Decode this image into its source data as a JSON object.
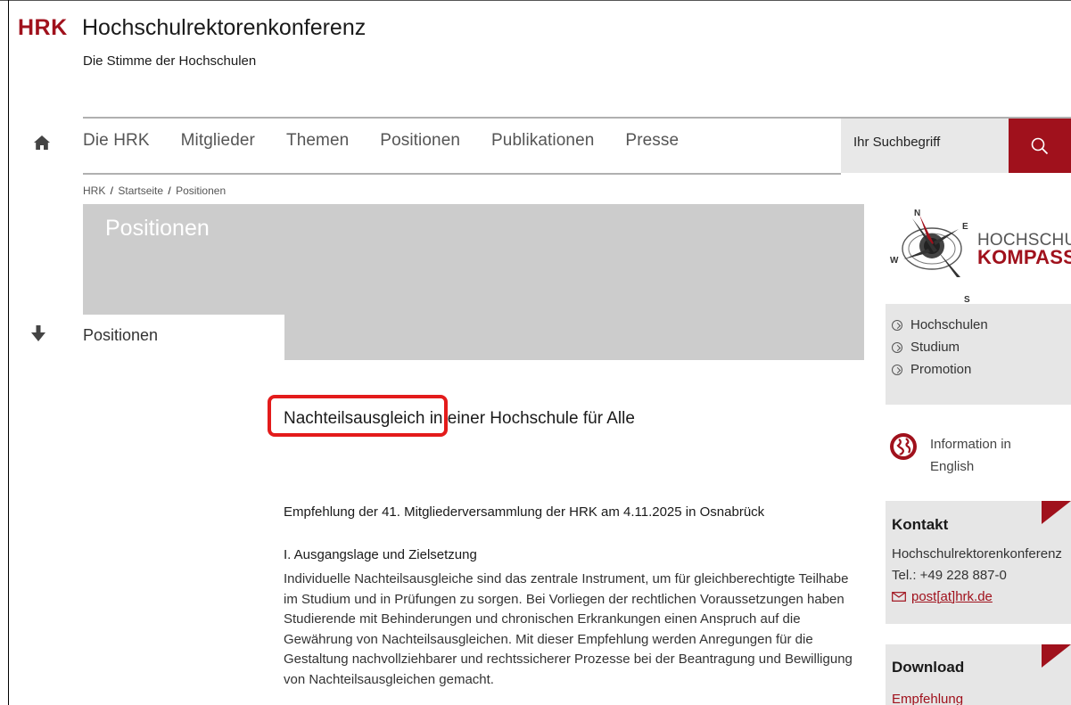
{
  "header": {
    "logo_abbr": "HRK",
    "logo_title": "Hochschulrektorenkonferenz",
    "logo_subtitle": "Die Stimme der Hochschulen"
  },
  "nav": {
    "home_icon": "home-icon",
    "items": [
      "Die HRK",
      "Mitglieder",
      "Themen",
      "Positionen",
      "Publikationen",
      "Presse"
    ]
  },
  "search": {
    "placeholder": "Ihr Suchbegriff",
    "button_icon": "search-icon"
  },
  "breadcrumb": [
    "HRK",
    "Startseite",
    "Positionen"
  ],
  "hero": {
    "title": "Positionen",
    "tab_label": "Positionen"
  },
  "article": {
    "title": "Nachteilsausgleich in einer Hochschule für Alle",
    "lead": "Empfehlung der 41. Mitgliederversammlung der HRK am 4.11.2025 in Osnabrück",
    "section_heading": "I. Ausgangslage und Zielsetzung",
    "body": "Individuelle Nachteilsausgleiche sind das zentrale Instrument, um für gleichberechtigte Teilhabe im Studium und in Prüfungen zu sorgen. Bei Vorliegen der rechtlichen Voraussetzungen haben Studierende mit Behinderungen und chronischen Erkrankungen einen Anspruch auf die Gewährung von Nachteilsausgleichen. Mit dieser Empfehlung werden Anregungen für die Gestaltung nachvollziehbarer und rechtssicherer Prozesse bei der Beantragung und Bewilligung von Nachteilsausgleichen gemacht."
  },
  "sidebar": {
    "kompass": {
      "compass_n": "N",
      "compass_e": "E",
      "compass_w": "W",
      "compass_s": "S",
      "word1": "HOCHSCHUL",
      "word2": "KOMPASS",
      "links": [
        "Hochschulen",
        "Studium",
        "Promotion"
      ]
    },
    "english": {
      "label": "Information in English"
    },
    "contact": {
      "title": "Kontakt",
      "org": "Hochschulrektorenkonferenz",
      "tel": "Tel.: +49 228 887-0",
      "email": "post[at]hrk.de"
    },
    "download": {
      "title": "Download",
      "link": "Empfehlung"
    }
  },
  "colors": {
    "brand_red": "#a0111c",
    "highlight_red": "#e31b1b",
    "hero_gray": "#cccccc",
    "card_gray": "#e6e6e6"
  }
}
